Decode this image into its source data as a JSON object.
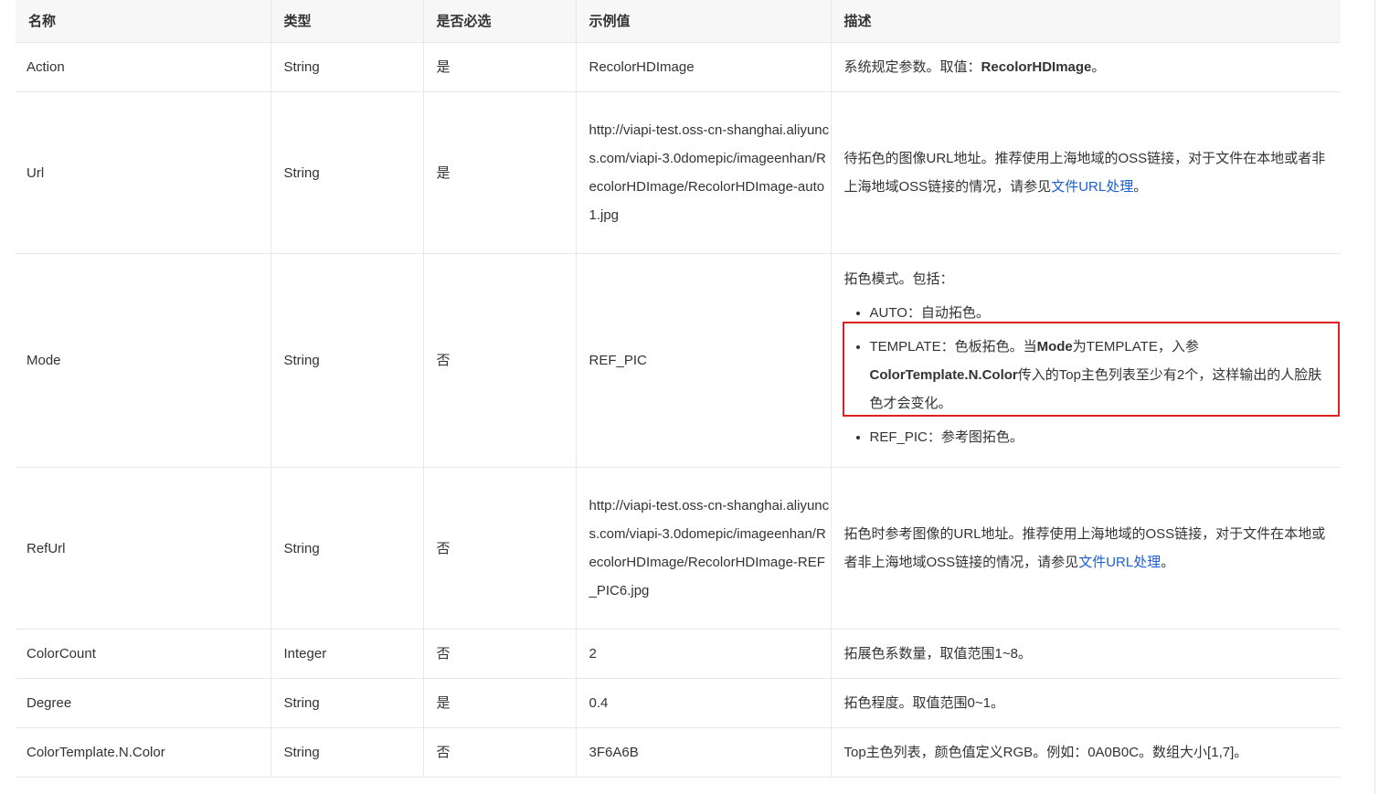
{
  "headers": [
    "名称",
    "类型",
    "是否必选",
    "示例值",
    "描述"
  ],
  "rows": [
    {
      "name": "Action",
      "type": "String",
      "required": "是",
      "example": "RecolorHDImage",
      "desc_prefix": "系统规定参数。取值：",
      "desc_bold": "RecolorHDImage",
      "desc_suffix": "。"
    },
    {
      "name": "Url",
      "type": "String",
      "required": "是",
      "example": "http://viapi-test.oss-cn-shanghai.aliyuncs.com/viapi-3.0domepic/imageenhan/RecolorHDImage/RecolorHDImage-auto1.jpg",
      "desc_prefix": "待拓色的图像URL地址。推荐使用上海地域的OSS链接，对于文件在本地或者非上海地域OSS链接的情况，请参见",
      "desc_link": "文件URL处理",
      "desc_suffix": "。"
    },
    {
      "name": "Mode",
      "type": "String",
      "required": "否",
      "example": "REF_PIC",
      "desc_intro": "拓色模式。包括：",
      "item1": "AUTO：自动拓色。",
      "item2_a": "TEMPLATE：色板拓色。当",
      "item2_b1": "Mode",
      "item2_c": "为TEMPLATE，入参",
      "item2_b2": "ColorTemplate.N.Color",
      "item2_d": "传入的Top主色列表至少有2个，这样输出的人脸肤色才会变化。",
      "item3": "REF_PIC：参考图拓色。"
    },
    {
      "name": "RefUrl",
      "type": "String",
      "required": "否",
      "example": "http://viapi-test.oss-cn-shanghai.aliyuncs.com/viapi-3.0domepic/imageenhan/RecolorHDImage/RecolorHDImage-REF_PIC6.jpg",
      "desc_prefix": "拓色时参考图像的URL地址。推荐使用上海地域的OSS链接，对于文件在本地或者非上海地域OSS链接的情况，请参见",
      "desc_link": "文件URL处理",
      "desc_suffix": "。"
    },
    {
      "name": "ColorCount",
      "type": "Integer",
      "required": "否",
      "example": "2",
      "desc_prefix": "拓展色系数量，取值范围1~8。"
    },
    {
      "name": "Degree",
      "type": "String",
      "required": "是",
      "example": "0.4",
      "desc_prefix": "拓色程度。取值范围0~1。"
    },
    {
      "name": "ColorTemplate.N.Color",
      "type": "String",
      "required": "否",
      "example": "3F6A6B",
      "desc_prefix": "Top主色列表，颜色值定义RGB。例如：0A0B0C。数组大小[1,7]。"
    }
  ]
}
